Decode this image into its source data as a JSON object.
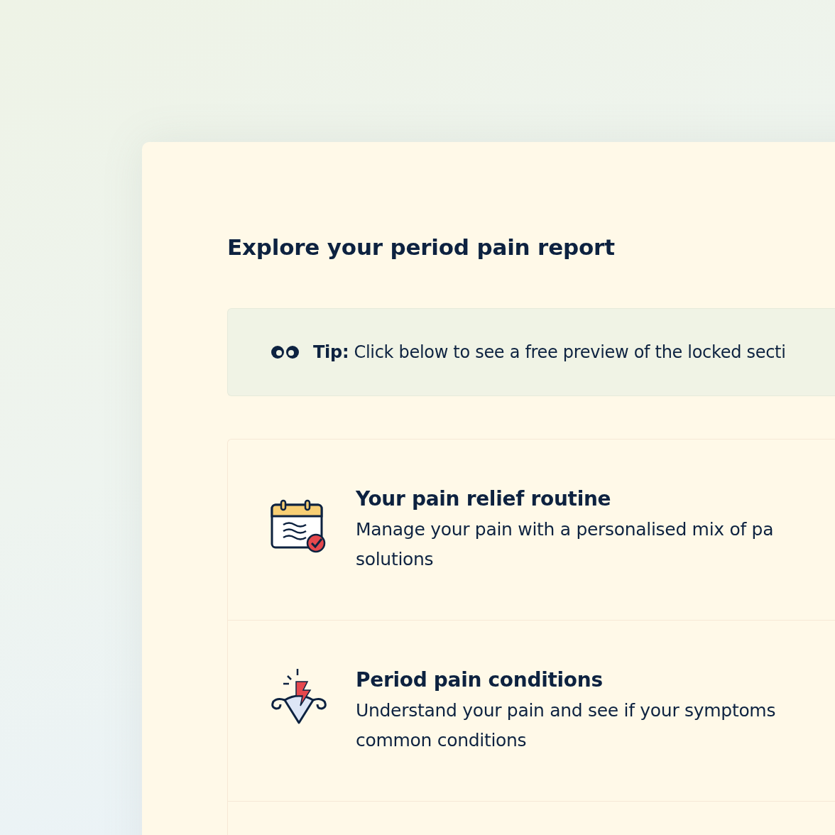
{
  "heading": "Explore your period pain report",
  "tip": {
    "label": "Tip:",
    "text": "Click below to see a free preview of the locked secti"
  },
  "sections": [
    {
      "kind": "routine",
      "title": "Your pain relief routine",
      "lines": [
        "Manage your pain with a personalised mix of pa",
        "solutions"
      ]
    },
    {
      "kind": "conditions",
      "title": "Period pain conditions",
      "lines": [
        "Understand your pain and see if your symptoms",
        "common conditions"
      ]
    }
  ]
}
